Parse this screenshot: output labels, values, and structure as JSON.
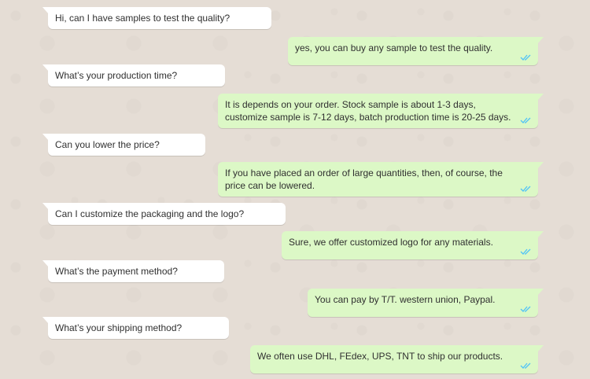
{
  "chat": {
    "messages": [
      {
        "dir": "in",
        "text": "Hi, can I have samples to test the quality?"
      },
      {
        "dir": "out",
        "text": "yes, you can buy any sample to test the quality."
      },
      {
        "dir": "in",
        "text": "What’s your production time?"
      },
      {
        "dir": "out",
        "text": "It is depends on your order. Stock sample is about 1-3 days, customize sample is 7-12 days, batch production time is 20-25 days."
      },
      {
        "dir": "in",
        "text": "Can you lower the price?"
      },
      {
        "dir": "out",
        "text": "If you have placed an order of large quantities, then, of course, the price can be lowered."
      },
      {
        "dir": "in",
        "text": "Can I customize the packaging and the logo?"
      },
      {
        "dir": "out",
        "text": "Sure, we offer customized logo for any materials."
      },
      {
        "dir": "in",
        "text": "What’s the payment method?"
      },
      {
        "dir": "out",
        "text": "You can pay by T/T. western union, Paypal."
      },
      {
        "dir": "in",
        "text": "What’s your shipping method?"
      },
      {
        "dir": "out",
        "text": "We often use DHL, FEdex, UPS, TNT to ship our products."
      }
    ],
    "colors": {
      "background": "#e5ddd5",
      "incoming": "#ffffff",
      "outgoing": "#dcf8c6",
      "read_ticks": "#4fc3f7"
    },
    "tick_icon": "double-check-read-icon"
  }
}
